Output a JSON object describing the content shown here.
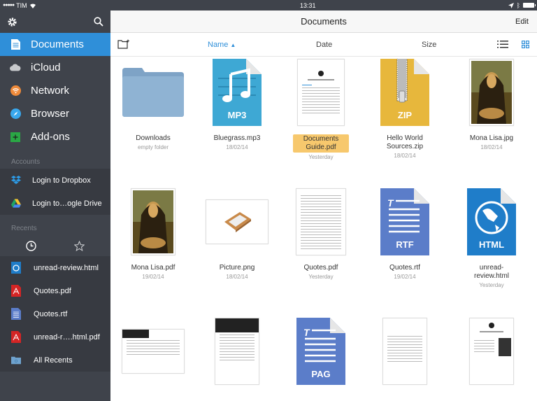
{
  "status_bar": {
    "carrier": "TIM",
    "time": "13:31"
  },
  "sidebar": {
    "nav": [
      {
        "label": "Documents",
        "icon": "document-icon",
        "active": true
      },
      {
        "label": "iCloud",
        "icon": "cloud-icon"
      },
      {
        "label": "Network",
        "icon": "wifi-icon"
      },
      {
        "label": "Browser",
        "icon": "compass-icon"
      },
      {
        "label": "Add-ons",
        "icon": "plus-icon"
      }
    ],
    "accounts_label": "Accounts",
    "accounts": [
      {
        "label": "Login to Dropbox",
        "icon": "dropbox-icon"
      },
      {
        "label": "Login to…ogle Drive",
        "icon": "google-drive-icon"
      }
    ],
    "recents_label": "Recents",
    "recents": [
      {
        "label": "unread-review.html",
        "icon": "html-file-icon"
      },
      {
        "label": "Quotes.pdf",
        "icon": "pdf-file-icon"
      },
      {
        "label": "Quotes.rtf",
        "icon": "rtf-file-icon"
      },
      {
        "label": "unread-r….html.pdf",
        "icon": "pdf-file-icon"
      },
      {
        "label": "All Recents",
        "icon": "folder-icon"
      }
    ]
  },
  "header": {
    "title": "Documents",
    "edit": "Edit"
  },
  "toolbar": {
    "name": "Name",
    "date": "Date",
    "size": "Size"
  },
  "files": [
    {
      "name": "Downloads",
      "sub": "empty folder",
      "kind": "folder"
    },
    {
      "name": "Bluegrass.mp3",
      "sub": "18/02/14",
      "kind": "mp3",
      "type_label": "MP3"
    },
    {
      "name": "Documents Guide.pdf",
      "sub": "Yesterday",
      "kind": "docguide",
      "selected": true
    },
    {
      "name": "Hello World Sources.zip",
      "sub": "18/02/14",
      "kind": "zip",
      "type_label": "ZIP"
    },
    {
      "name": "Mona Lisa.jpg",
      "sub": "18/02/14",
      "kind": "painting"
    },
    {
      "name": "Mona Lisa.pdf",
      "sub": "19/02/14",
      "kind": "painting"
    },
    {
      "name": "Picture.png",
      "sub": "18/02/14",
      "kind": "picture"
    },
    {
      "name": "Quotes.pdf",
      "sub": "Yesterday",
      "kind": "textdoc"
    },
    {
      "name": "Quotes.rtf",
      "sub": "19/02/14",
      "kind": "rtf",
      "type_label": "RTF"
    },
    {
      "name": "unread-review.html",
      "sub": "Yesterday",
      "kind": "html",
      "type_label": "HTML"
    },
    {
      "name": "",
      "sub": "",
      "kind": "webland"
    },
    {
      "name": "",
      "sub": "",
      "kind": "webport"
    },
    {
      "name": "",
      "sub": "",
      "kind": "pag",
      "type_label": "PAG"
    },
    {
      "name": "",
      "sub": "",
      "kind": "textdoc2"
    },
    {
      "name": "",
      "sub": "",
      "kind": "whatsnew"
    }
  ]
}
